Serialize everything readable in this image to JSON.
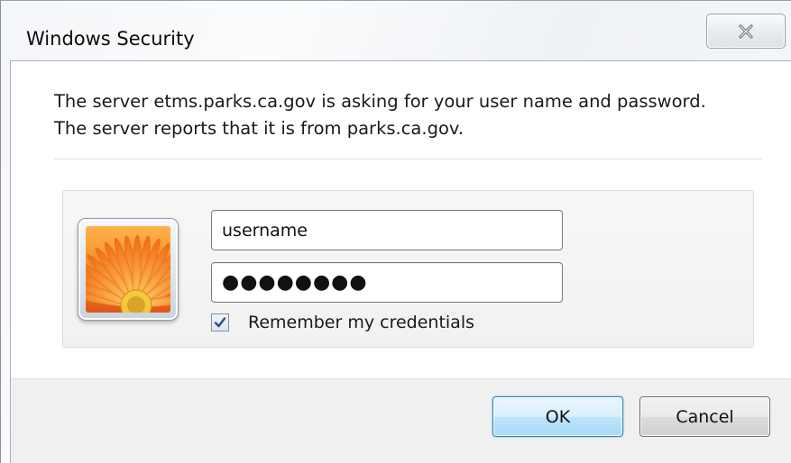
{
  "window": {
    "title": "Windows Security"
  },
  "message": {
    "line1": "The server etms.parks.ca.gov is asking for your user name and password.",
    "line2": "The server reports that it is from parks.ca.gov."
  },
  "credentials": {
    "username_value": "username",
    "password_value": "●●●●●●●●",
    "remember_label": "Remember my credentials",
    "remember_checked": true
  },
  "buttons": {
    "ok_label": "OK",
    "cancel_label": "Cancel"
  },
  "icons": {
    "close": "close-icon",
    "user_tile": "user-picture-flower-icon",
    "check": "checkmark-icon"
  },
  "colors": {
    "ok_button_accent": "#3c7fb1",
    "check_color": "#2b4f8c",
    "flower": "#f07a1a"
  }
}
